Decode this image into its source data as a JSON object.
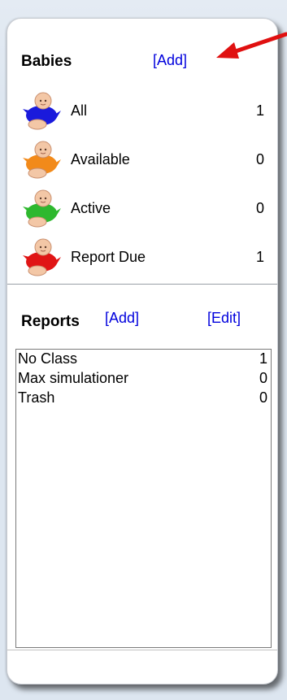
{
  "babies": {
    "title": "Babies",
    "add_label": "[Add]",
    "items": [
      {
        "label": "All",
        "count": "1",
        "icon": "baby-blue-icon",
        "color": "#1a1adc"
      },
      {
        "label": "Available",
        "count": "0",
        "icon": "baby-orange-icon",
        "color": "#f28a1a"
      },
      {
        "label": "Active",
        "count": "0",
        "icon": "baby-green-icon",
        "color": "#2eb82e"
      },
      {
        "label": "Report Due",
        "count": "1",
        "icon": "baby-red-icon",
        "color": "#e01515"
      }
    ]
  },
  "reports": {
    "title": "Reports",
    "add_label": "[Add]",
    "edit_label": "[Edit]",
    "items": [
      {
        "name": "No Class",
        "count": "1"
      },
      {
        "name": "Max simulationer",
        "count": "0"
      },
      {
        "name": "Trash",
        "count": "0"
      }
    ]
  },
  "colors": {
    "link": "#0000dd",
    "arrow": "#e01010",
    "skin": "#f3c7a6"
  }
}
